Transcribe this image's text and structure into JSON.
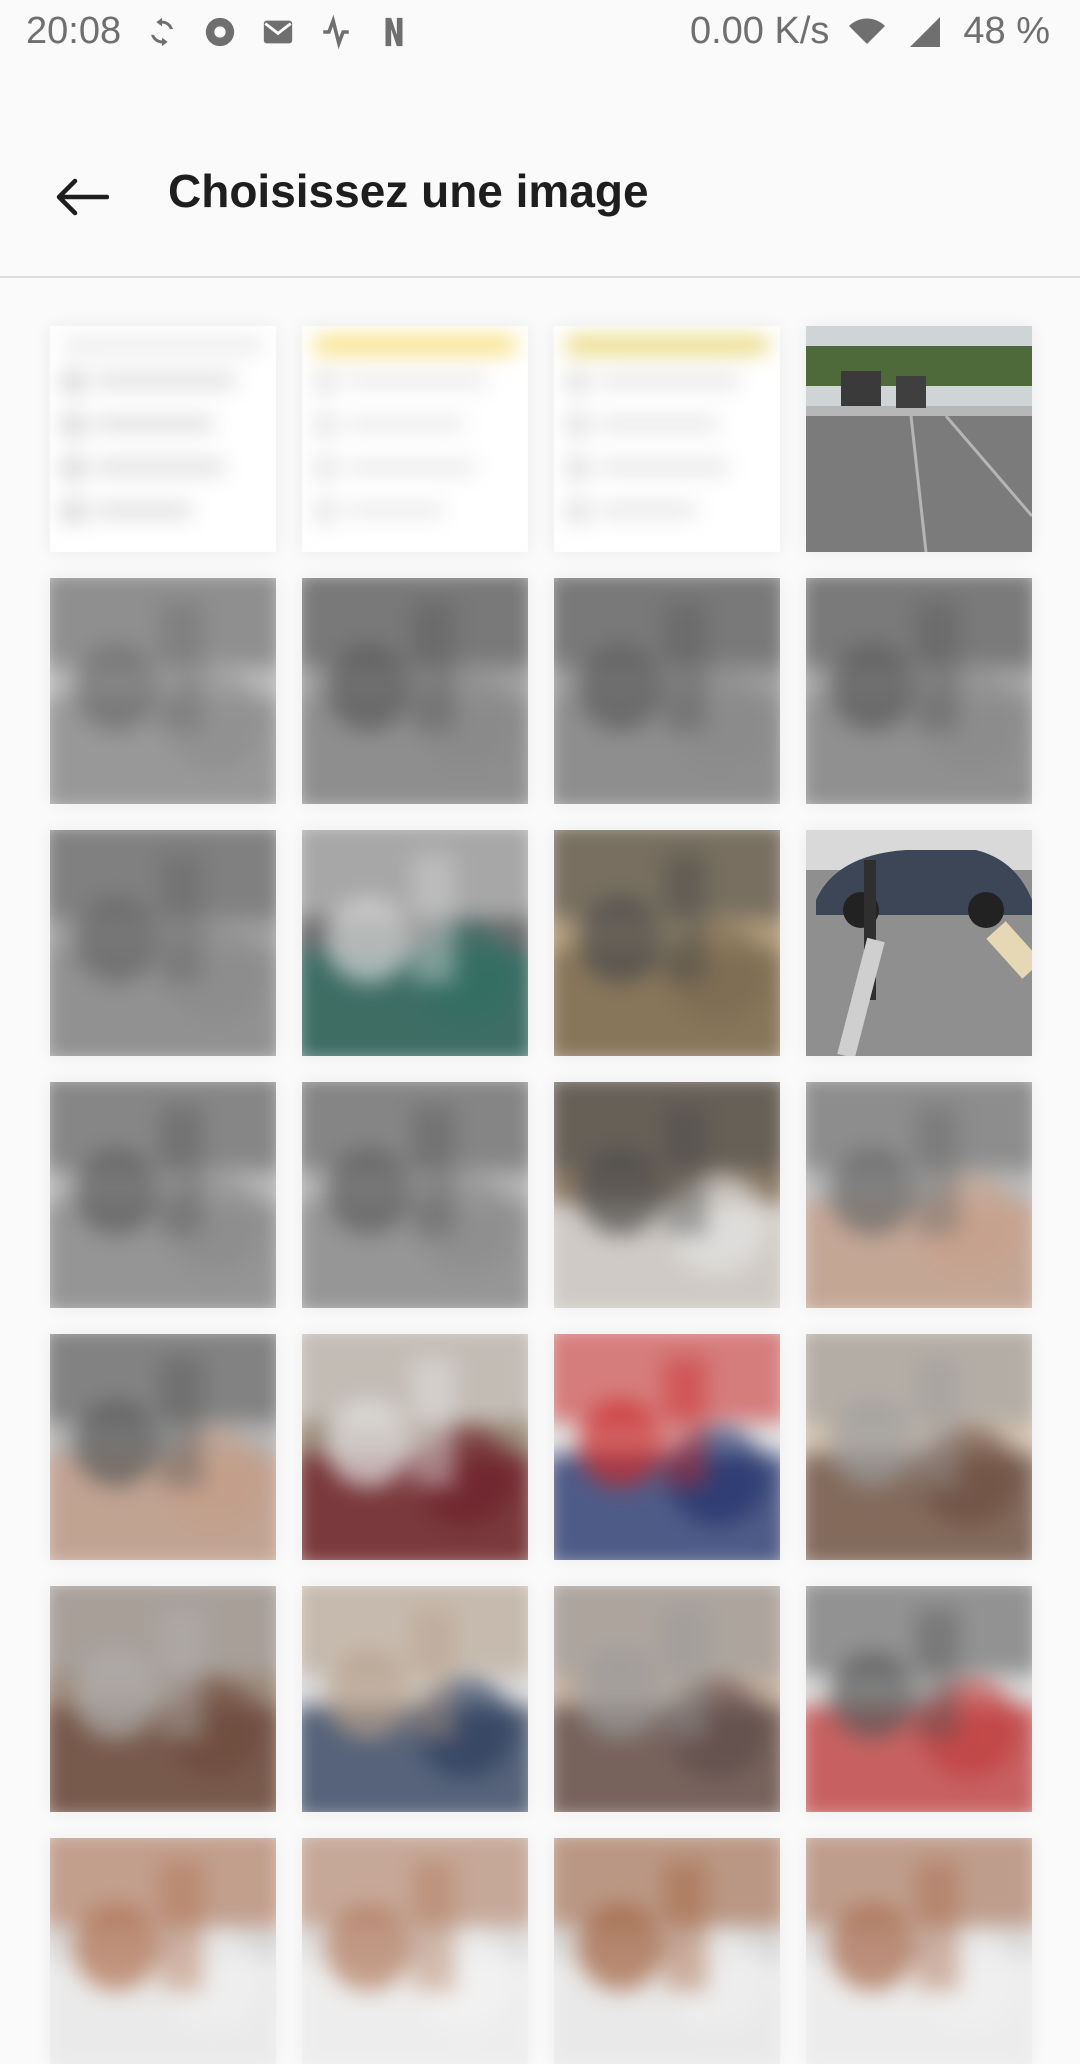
{
  "status_bar": {
    "time": "20:08",
    "speed": "0.00 K/s",
    "battery": "48 %",
    "icons": [
      "sync-icon",
      "record-icon",
      "mail-icon",
      "activity-icon",
      "netflix-icon",
      "wifi-icon",
      "signal-icon"
    ]
  },
  "app_bar": {
    "title": "Choisissez une image",
    "back_icon": "arrow-back-icon"
  },
  "grid": {
    "columns": 4,
    "tiles": [
      {
        "id": 1,
        "kind": "screenshot-list",
        "blurred": true,
        "colors": [
          "#ffffff",
          "#e6e6e6",
          "#d0d0d0"
        ]
      },
      {
        "id": 2,
        "kind": "screenshot-text",
        "blurred": true,
        "colors": [
          "#ffffff",
          "#f4d24a",
          "#e2e2e2"
        ]
      },
      {
        "id": 3,
        "kind": "screenshot-list",
        "blurred": true,
        "colors": [
          "#ffffff",
          "#e0c84a",
          "#dcdcdc"
        ]
      },
      {
        "id": 4,
        "kind": "street-bins",
        "blurred": false,
        "colors": [
          "#7b7b7b",
          "#4f6a3a",
          "#b7b7b7"
        ]
      },
      {
        "id": 5,
        "kind": "building",
        "blurred": true,
        "colors": [
          "#8d8d8d",
          "#6e6e6e",
          "#b9b9b9"
        ]
      },
      {
        "id": 6,
        "kind": "car-street",
        "blurred": true,
        "colors": [
          "#888888",
          "#5a5a5a",
          "#a0a0a0"
        ]
      },
      {
        "id": 7,
        "kind": "car-street",
        "blurred": true,
        "colors": [
          "#8a8a8a",
          "#5d5d5d",
          "#9c9c9c"
        ]
      },
      {
        "id": 8,
        "kind": "car-street",
        "blurred": true,
        "colors": [
          "#8a8a8a",
          "#5a5a5a",
          "#a3a3a3"
        ]
      },
      {
        "id": 9,
        "kind": "car-street",
        "blurred": true,
        "colors": [
          "#8c8c8c",
          "#666666",
          "#9f9f9f"
        ]
      },
      {
        "id": 10,
        "kind": "shop-front",
        "blurred": true,
        "colors": [
          "#2f6e62",
          "#d7d7d7",
          "#6d6d6d"
        ]
      },
      {
        "id": 11,
        "kind": "people",
        "blurred": true,
        "colors": [
          "#7b6a52",
          "#4a4a4a",
          "#b09b7a"
        ]
      },
      {
        "id": 12,
        "kind": "parked-car",
        "blurred": false,
        "colors": [
          "#3c4656",
          "#8f8f8f",
          "#cfcfcf"
        ]
      },
      {
        "id": 13,
        "kind": "street",
        "blurred": true,
        "colors": [
          "#8a8a8a",
          "#5e5e5e",
          "#b6b6b6"
        ]
      },
      {
        "id": 14,
        "kind": "street",
        "blurred": true,
        "colors": [
          "#8c8c8c",
          "#5e5e5e",
          "#b3b3b3"
        ]
      },
      {
        "id": 15,
        "kind": "car-closeup",
        "blurred": true,
        "colors": [
          "#e5e5e5",
          "#4b4b4b",
          "#8b7a66"
        ]
      },
      {
        "id": 16,
        "kind": "person-field",
        "blurred": true,
        "colors": [
          "#c8a08a",
          "#6a6a6a",
          "#b9b9b9"
        ]
      },
      {
        "id": 17,
        "kind": "person-field",
        "blurred": true,
        "colors": [
          "#c59d87",
          "#5a5a5a",
          "#b4b4b4"
        ]
      },
      {
        "id": 18,
        "kind": "people-table",
        "blurred": true,
        "colors": [
          "#6f1e2a",
          "#e6e6e6",
          "#9a8a7a"
        ]
      },
      {
        "id": 19,
        "kind": "people-table",
        "blurred": true,
        "colors": [
          "#1f2f6a",
          "#cc2a2a",
          "#e0e0e0"
        ]
      },
      {
        "id": 20,
        "kind": "crowd",
        "blurred": true,
        "colors": [
          "#6a4c3f",
          "#9c9c9c",
          "#d0c1b0"
        ]
      },
      {
        "id": 21,
        "kind": "crowd",
        "blurred": true,
        "colors": [
          "#6c4a3c",
          "#b1b1b1",
          "#9d8b7c"
        ]
      },
      {
        "id": 22,
        "kind": "crowd",
        "blurred": true,
        "colors": [
          "#2a3b5a",
          "#b7a08a",
          "#d9d9d9"
        ]
      },
      {
        "id": 23,
        "kind": "crowd",
        "blurred": true,
        "colors": [
          "#5d4a46",
          "#9a9a9a",
          "#c2b0a0"
        ]
      },
      {
        "id": 24,
        "kind": "crowd",
        "blurred": true,
        "colors": [
          "#c23a3a",
          "#5a5a5a",
          "#d7d7d7"
        ]
      },
      {
        "id": 25,
        "kind": "outdoor",
        "blurred": true,
        "colors": [
          "#f0f0f0",
          "#b07050",
          "#d8d8d8"
        ]
      },
      {
        "id": 26,
        "kind": "outdoor",
        "blurred": true,
        "colors": [
          "#f2f2f2",
          "#b27b5e",
          "#dedede"
        ]
      },
      {
        "id": 27,
        "kind": "outdoor",
        "blurred": true,
        "colors": [
          "#efefef",
          "#a3623f",
          "#d7d7d7"
        ]
      },
      {
        "id": 28,
        "kind": "outdoor",
        "blurred": true,
        "colors": [
          "#f1f1f1",
          "#a86a4b",
          "#dcdcdc"
        ]
      }
    ]
  }
}
